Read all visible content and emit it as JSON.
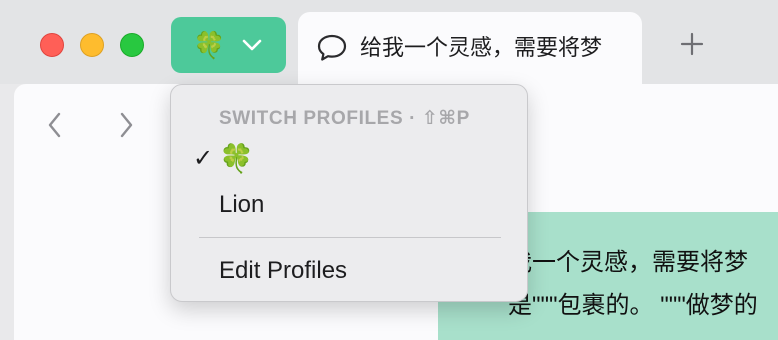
{
  "window": {
    "traffic_lights": {
      "close": "#ff5f57",
      "minimize": "#febc2e",
      "maximize": "#28c840"
    }
  },
  "profile_button": {
    "icon": "four-leaf-clover",
    "emoji": "🍀",
    "accent": "#4dc99a"
  },
  "tab": {
    "icon": "chat-bubble-icon",
    "title": "给我一个灵感，需要将梦"
  },
  "toolbar": {
    "new_tab_icon": "plus-icon",
    "back_icon": "chevron-left-icon",
    "forward_icon": "chevron-right-icon"
  },
  "profiles_menu": {
    "header": "SWITCH PROFILES · ⇧⌘P",
    "items": [
      {
        "label": "🍀",
        "checked": true,
        "check": "✓"
      },
      {
        "label": "Lion",
        "checked": false
      }
    ],
    "edit_label": "Edit Profiles"
  },
  "message": {
    "lines": [
      "我一个灵感，需要将梦",
      "是\"\"\"包裹的。 \"\"\"做梦的"
    ],
    "bg": "#a8e0cb"
  }
}
